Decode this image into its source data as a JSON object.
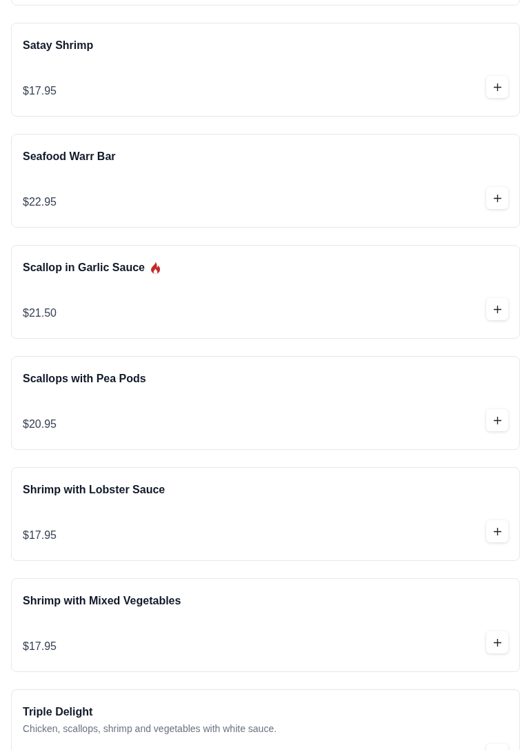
{
  "items": [
    {
      "name": "Satay Shrimp",
      "price": "$17.95",
      "spicy": false
    },
    {
      "name": "Seafood Warr Bar",
      "price": "$22.95",
      "spicy": false
    },
    {
      "name": "Scallop in Garlic Sauce",
      "price": "$21.50",
      "spicy": true
    },
    {
      "name": "Scallops with Pea Pods",
      "price": "$20.95",
      "spicy": false
    },
    {
      "name": "Shrimp with Lobster Sauce",
      "price": "$17.95",
      "spicy": false
    },
    {
      "name": "Shrimp with Mixed Vegetables",
      "price": "$17.95",
      "spicy": false
    },
    {
      "name": "Triple Delight",
      "description": "Chicken, scallops, shrimp and vegetables with white sauce.",
      "spicy": false
    }
  ]
}
